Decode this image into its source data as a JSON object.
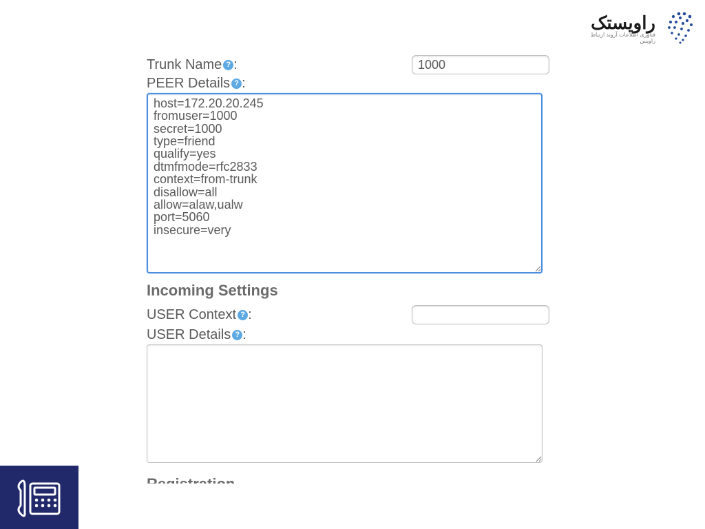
{
  "brand": {
    "word": "راویستک",
    "tagline": "فناوری اطلاعات آروند ارتباط راویس"
  },
  "trunk": {
    "name_label": "Trunk Name",
    "name_value": "1000"
  },
  "peer": {
    "label": "PEER Details",
    "details": "host=172.20.20.245\nfromuser=1000\nsecret=1000\ntype=friend\nqualify=yes\ndtmfmode=rfc2833\ncontext=from-trunk\ndisallow=all\nallow=alaw,ualw\nport=5060\ninsecure=very"
  },
  "incoming": {
    "heading": "Incoming Settings"
  },
  "user": {
    "context_label": "USER Context",
    "context_value": "",
    "details_label": "USER Details",
    "details_value": ""
  },
  "registration": {
    "heading": "Registration"
  },
  "help_glyph": "?"
}
